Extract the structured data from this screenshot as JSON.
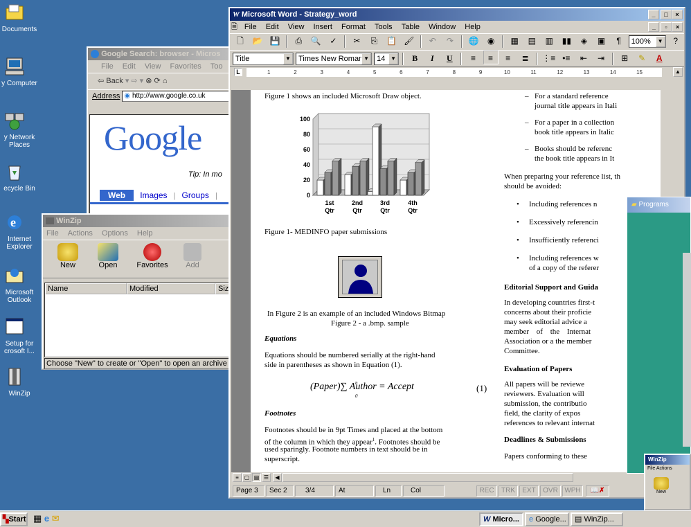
{
  "desktop": {
    "icons": [
      {
        "label": "Documents",
        "icon": "folder-icon"
      },
      {
        "label": "y Computer",
        "icon": "computer-icon"
      },
      {
        "label": "y Network Places",
        "icon": "network-icon"
      },
      {
        "label": "ecycle Bin",
        "icon": "recycle-bin-icon"
      },
      {
        "label": "Internet Explorer",
        "icon": "ie-icon"
      },
      {
        "label": "Microsoft Outlook",
        "icon": "outlook-icon"
      },
      {
        "label": "Setup for crosoft I...",
        "icon": "setup-icon"
      },
      {
        "label": "WinZip",
        "icon": "winzip-icon"
      }
    ]
  },
  "google_window": {
    "title": "Google Search: browser - Micros",
    "menu": [
      "File",
      "Edit",
      "View",
      "Favorites",
      "Too"
    ],
    "back_label": "Back",
    "address_label": "Address",
    "address_value": "http://www.google.co.uk",
    "logo": "Google",
    "tip": "Tip: In mo",
    "tabs": [
      "Web",
      "Images",
      "Groups"
    ]
  },
  "winzip_window": {
    "title": "WinZip",
    "menu": [
      "File",
      "Actions",
      "Options",
      "Help"
    ],
    "toolbar": [
      "New",
      "Open",
      "Favorites",
      "Add"
    ],
    "columns": [
      "Name",
      "Modified",
      "Siz"
    ],
    "status": "Choose \"New\" to create or \"Open\" to open an archive"
  },
  "word_window": {
    "title": "Microsoft Word - Strategy_word",
    "menu": [
      "File",
      "Edit",
      "View",
      "Insert",
      "Format",
      "Tools",
      "Table",
      "Window",
      "Help"
    ],
    "zoom": "100%",
    "style": "Title",
    "font": "Times New Roman",
    "size": "14",
    "ruler_numbers": [
      "1",
      "2",
      "3",
      "4",
      "5",
      "6",
      "7",
      "8",
      "9",
      "10",
      "11",
      "12",
      "13",
      "14",
      "15"
    ],
    "left_col": {
      "fig1_caption_top": "Figure 1 shows an included Microsoft Draw object.",
      "fig1_caption": "Figure 1- MEDINFO paper submissions",
      "fig2_text1": "In Figure 2 is an example of an included Windows Bitmap",
      "fig2_text2": "Figure 2 - a .bmp. sample",
      "equations_heading": "Equations",
      "equations_p1": "Equations should be numbered serially at the right-hand",
      "equations_p2": "side in parentheses as shown in Equation (1).",
      "equation": "(Paper)∑ Author = Accept",
      "eq_upper": "n",
      "eq_lower": "0",
      "equation_number": "(1)",
      "footnotes_heading": "Footnotes",
      "footnotes_l1": "Footnotes should be in 9pt Times and placed at the bottom",
      "footnotes_l2": "of the column in which they appear",
      "footnotes_sup": "1",
      "footnotes_l2b": ". Footnotes should be",
      "footnotes_l3": "used sparingly. Footnote numbers in text should be in",
      "footnotes_l4": "superscript."
    },
    "right_col": {
      "dash1_l1": "For a standard reference",
      "dash1_l2": "journal title appears in Itali",
      "dash2_l1": "For a paper in a collection",
      "dash2_l2": "book title appears in Italic",
      "dash3_l1": "Books should be referenc",
      "dash3_l2": "the book title appears in It",
      "prep_l1": "When preparing your reference list, th",
      "prep_l2": "should be avoided:",
      "bullets": [
        "Including references n",
        "Excessively referencin",
        "Insufficiently referenci",
        "Including references w"
      ],
      "bullet4_l2": "of a copy of the referer",
      "editorial_heading": "Editorial Support and Guida",
      "editorial_lines": [
        "In developing countries first-t",
        "concerns about their proficie",
        "may seek editorial advice a",
        "member of the Internat",
        "Association or a the member",
        "Committee."
      ],
      "evaluation_heading": "Evaluation of Papers",
      "evaluation_lines": [
        "All papers will be reviewe",
        "reviewers. Evaluation will",
        "submission, the contributio",
        "field, the clarity of expos",
        "references to relevant internat"
      ],
      "deadlines_heading": "Deadlines & Submissions",
      "deadlines_line": "Papers conforming to these"
    },
    "status": {
      "page": "Page 3",
      "sec": "Sec 2",
      "pages": "3/4",
      "at": "At",
      "ln": "Ln",
      "col": "Col",
      "flags": [
        "REC",
        "TRK",
        "EXT",
        "OVR",
        "WPH"
      ]
    }
  },
  "chart_data": {
    "type": "bar",
    "categories": [
      "1st Qtr",
      "2nd Qtr",
      "3rd Qtr",
      "4th Qtr"
    ],
    "series": [
      {
        "values": [
          20,
          27,
          90,
          20
        ]
      },
      {
        "values": [
          30,
          38,
          35,
          30
        ]
      },
      {
        "values": [
          45,
          45,
          45,
          43
        ]
      },
      {
        "values": [
          0,
          5,
          0,
          0
        ]
      }
    ],
    "yticks": [
      "0",
      "20",
      "40",
      "60",
      "80",
      "100"
    ],
    "ylim": [
      0,
      100
    ]
  },
  "programs_window": {
    "title": "Programs"
  },
  "winzip_small": {
    "title": "WinZip",
    "menu": [
      "File",
      "Actions"
    ],
    "button": "New"
  },
  "taskbar": {
    "start": "Start",
    "tasks": [
      "Micro...",
      "Google...",
      "WinZip..."
    ]
  }
}
